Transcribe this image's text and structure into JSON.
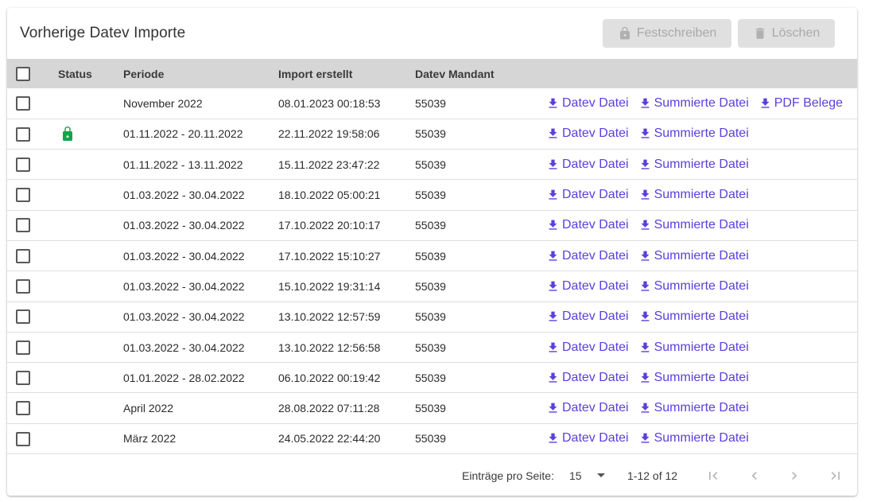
{
  "card": {
    "title": "Vorherige Datev Importe",
    "btn_lock": "Festschreiben",
    "btn_delete": "Löschen"
  },
  "table": {
    "headers": {
      "status": "Status",
      "period": "Periode",
      "created": "Import erstellt",
      "mandant": "Datev Mandant"
    },
    "link_labels": {
      "datev": "Datev Datei",
      "summed": "Summierte Datei",
      "pdf": "PDF Belege"
    },
    "rows": [
      {
        "locked": false,
        "period": "November 2022",
        "created": "08.01.2023 00:18:53",
        "mandant": "55039",
        "pdf": true
      },
      {
        "locked": true,
        "period": "01.11.2022 - 20.11.2022",
        "created": "22.11.2022 19:58:06",
        "mandant": "55039",
        "pdf": false
      },
      {
        "locked": false,
        "period": "01.11.2022 - 13.11.2022",
        "created": "15.11.2022 23:47:22",
        "mandant": "55039",
        "pdf": false
      },
      {
        "locked": false,
        "period": "01.03.2022 - 30.04.2022",
        "created": "18.10.2022 05:00:21",
        "mandant": "55039",
        "pdf": false
      },
      {
        "locked": false,
        "period": "01.03.2022 - 30.04.2022",
        "created": "17.10.2022 20:10:17",
        "mandant": "55039",
        "pdf": false
      },
      {
        "locked": false,
        "period": "01.03.2022 - 30.04.2022",
        "created": "17.10.2022 15:10:27",
        "mandant": "55039",
        "pdf": false
      },
      {
        "locked": false,
        "period": "01.03.2022 - 30.04.2022",
        "created": "15.10.2022 19:31:14",
        "mandant": "55039",
        "pdf": false
      },
      {
        "locked": false,
        "period": "01.03.2022 - 30.04.2022",
        "created": "13.10.2022 12:57:59",
        "mandant": "55039",
        "pdf": false
      },
      {
        "locked": false,
        "period": "01.03.2022 - 30.04.2022",
        "created": "13.10.2022 12:56:58",
        "mandant": "55039",
        "pdf": false
      },
      {
        "locked": false,
        "period": "01.01.2022 - 28.02.2022",
        "created": "06.10.2022 00:19:42",
        "mandant": "55039",
        "pdf": false
      },
      {
        "locked": false,
        "period": "April 2022",
        "created": "28.08.2022 07:11:28",
        "mandant": "55039",
        "pdf": false
      },
      {
        "locked": false,
        "period": "März 2022",
        "created": "24.05.2022 22:44:20",
        "mandant": "55039",
        "pdf": false
      }
    ]
  },
  "footer": {
    "per_page_label": "Einträge pro Seite:",
    "per_page_value": "15",
    "range": "1-12 of 12"
  },
  "colors": {
    "link": "#5b3fdc",
    "lock_status": "#16a34a",
    "header_bg": "#d6d6d6"
  }
}
